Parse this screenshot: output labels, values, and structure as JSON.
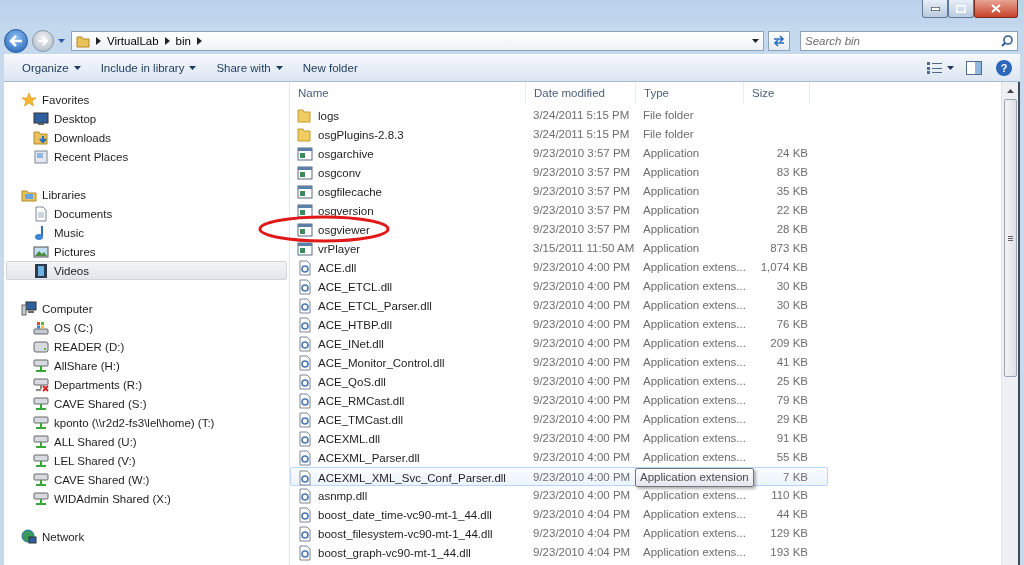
{
  "address_bar": {
    "crumbs": [
      "VirtualLab",
      "bin"
    ]
  },
  "search": {
    "placeholder": "Search bin"
  },
  "toolbar": {
    "help": "?",
    "buttons": [
      {
        "label": "Organize",
        "dropdown": true
      },
      {
        "label": "Include in library",
        "dropdown": true
      },
      {
        "label": "Share with",
        "dropdown": true
      },
      {
        "label": "New folder",
        "dropdown": false
      }
    ]
  },
  "sidebar": {
    "groups": [
      {
        "label": "Favorites",
        "kind": "favorites",
        "children": [
          {
            "label": "Desktop",
            "kind": "desktop",
            "selected": false
          },
          {
            "label": "Downloads",
            "kind": "downloads",
            "selected": false
          },
          {
            "label": "Recent Places",
            "kind": "recent",
            "selected": false
          }
        ]
      },
      {
        "label": "Libraries",
        "kind": "libraries",
        "children": [
          {
            "label": "Documents",
            "kind": "documents",
            "selected": false
          },
          {
            "label": "Music",
            "kind": "music",
            "selected": false
          },
          {
            "label": "Pictures",
            "kind": "pictures",
            "selected": false
          },
          {
            "label": "Videos",
            "kind": "videos",
            "selected": true
          }
        ]
      },
      {
        "label": "Computer",
        "kind": "computer",
        "children": [
          {
            "label": "OS (C:)",
            "kind": "os-drive",
            "selected": false
          },
          {
            "label": "READER (D:)",
            "kind": "drive",
            "selected": false
          },
          {
            "label": "AllShare (H:)",
            "kind": "net-drive",
            "selected": false
          },
          {
            "label": "Departments (R:)",
            "kind": "net-drive-off",
            "selected": false
          },
          {
            "label": "CAVE Shared (S:)",
            "kind": "net-drive",
            "selected": false
          },
          {
            "label": "kponto (\\\\r2d2-fs3\\lel\\home) (T:)",
            "kind": "net-drive",
            "selected": false
          },
          {
            "label": "ALL Shared (U:)",
            "kind": "net-drive",
            "selected": false
          },
          {
            "label": "LEL Shared (V:)",
            "kind": "net-drive",
            "selected": false
          },
          {
            "label": "CAVE Shared (W:)",
            "kind": "net-drive",
            "selected": false
          },
          {
            "label": "WIDAdmin Shared (X:)",
            "kind": "net-drive",
            "selected": false
          }
        ]
      },
      {
        "label": "Network",
        "kind": "network"
      }
    ]
  },
  "table": {
    "columns": [
      "Name",
      "Date modified",
      "Type",
      "Size"
    ],
    "rows": [
      {
        "kind": "folder",
        "name": "logs",
        "date": "3/24/2011 5:15 PM",
        "type": "File folder",
        "hovered": false,
        "circled": false
      },
      {
        "kind": "folder",
        "name": "osgPlugins-2.8.3",
        "date": "3/24/2011 5:15 PM",
        "type": "File folder",
        "hovered": false,
        "circled": false
      },
      {
        "kind": "app",
        "name": "osgarchive",
        "date": "9/23/2010 3:57 PM",
        "type": "Application",
        "size": "24 KB",
        "hovered": false,
        "circled": false
      },
      {
        "kind": "app",
        "name": "osgconv",
        "date": "9/23/2010 3:57 PM",
        "type": "Application",
        "size": "83 KB",
        "hovered": false,
        "circled": false
      },
      {
        "kind": "app",
        "name": "osgfilecache",
        "date": "9/23/2010 3:57 PM",
        "type": "Application",
        "size": "35 KB",
        "hovered": false,
        "circled": false
      },
      {
        "kind": "app",
        "name": "osgversion",
        "date": "9/23/2010 3:57 PM",
        "type": "Application",
        "size": "22 KB",
        "hovered": false,
        "circled": false
      },
      {
        "kind": "app",
        "name": "osgviewer",
        "date": "9/23/2010 3:57 PM",
        "type": "Application",
        "size": "28 KB",
        "hovered": false,
        "circled": true
      },
      {
        "kind": "app",
        "name": "vrPlayer",
        "date": "3/15/2011 11:50 AM",
        "type": "Application",
        "size": "873 KB",
        "hovered": false,
        "circled": false
      },
      {
        "kind": "dll",
        "name": "ACE.dll",
        "date": "9/23/2010 4:00 PM",
        "type": "Application extens...",
        "size": "1,074 KB",
        "hovered": false,
        "circled": false
      },
      {
        "kind": "dll",
        "name": "ACE_ETCL.dll",
        "date": "9/23/2010 4:00 PM",
        "type": "Application extens...",
        "size": "30 KB",
        "hovered": false,
        "circled": false
      },
      {
        "kind": "dll",
        "name": "ACE_ETCL_Parser.dll",
        "date": "9/23/2010 4:00 PM",
        "type": "Application extens...",
        "size": "30 KB",
        "hovered": false,
        "circled": false
      },
      {
        "kind": "dll",
        "name": "ACE_HTBP.dll",
        "date": "9/23/2010 4:00 PM",
        "type": "Application extens...",
        "size": "76 KB",
        "hovered": false,
        "circled": false
      },
      {
        "kind": "dll",
        "name": "ACE_INet.dll",
        "date": "9/23/2010 4:00 PM",
        "type": "Application extens...",
        "size": "209 KB",
        "hovered": false,
        "circled": false
      },
      {
        "kind": "dll",
        "name": "ACE_Monitor_Control.dll",
        "date": "9/23/2010 4:00 PM",
        "type": "Application extens...",
        "size": "41 KB",
        "hovered": false,
        "circled": false
      },
      {
        "kind": "dll",
        "name": "ACE_QoS.dll",
        "date": "9/23/2010 4:00 PM",
        "type": "Application extens...",
        "size": "25 KB",
        "hovered": false,
        "circled": false
      },
      {
        "kind": "dll",
        "name": "ACE_RMCast.dll",
        "date": "9/23/2010 4:00 PM",
        "type": "Application extens...",
        "size": "79 KB",
        "hovered": false,
        "circled": false
      },
      {
        "kind": "dll",
        "name": "ACE_TMCast.dll",
        "date": "9/23/2010 4:00 PM",
        "type": "Application extens...",
        "size": "29 KB",
        "hovered": false,
        "circled": false
      },
      {
        "kind": "dll",
        "name": "ACEXML.dll",
        "date": "9/23/2010 4:00 PM",
        "type": "Application extens...",
        "size": "91 KB",
        "hovered": false,
        "circled": false
      },
      {
        "kind": "dll",
        "name": "ACEXML_Parser.dll",
        "date": "9/23/2010 4:00 PM",
        "type": "Application extens...",
        "size": "55 KB",
        "hovered": false,
        "circled": false
      },
      {
        "kind": "dll",
        "name": "ACEXML_XML_Svc_Conf_Parser.dll",
        "date": "9/23/2010 4:00 PM",
        "tooltip": "Application extension",
        "size": "7 KB",
        "hovered": true,
        "circled": false
      },
      {
        "kind": "dll",
        "name": "asnmp.dll",
        "date": "9/23/2010 4:00 PM",
        "type": "Application extens...",
        "size": "110 KB",
        "hovered": false,
        "circled": false
      },
      {
        "kind": "dll",
        "name": "boost_date_time-vc90-mt-1_44.dll",
        "date": "9/23/2010 4:04 PM",
        "type": "Application extens...",
        "size": "44 KB",
        "hovered": false,
        "circled": false
      },
      {
        "kind": "dll",
        "name": "boost_filesystem-vc90-mt-1_44.dll",
        "date": "9/23/2010 4:04 PM",
        "type": "Application extens...",
        "size": "129 KB",
        "hovered": false,
        "circled": false
      },
      {
        "kind": "dll",
        "name": "boost_graph-vc90-mt-1_44.dll",
        "date": "9/23/2010 4:04 PM",
        "type": "Application extens...",
        "size": "193 KB",
        "hovered": false,
        "circled": false
      }
    ]
  }
}
